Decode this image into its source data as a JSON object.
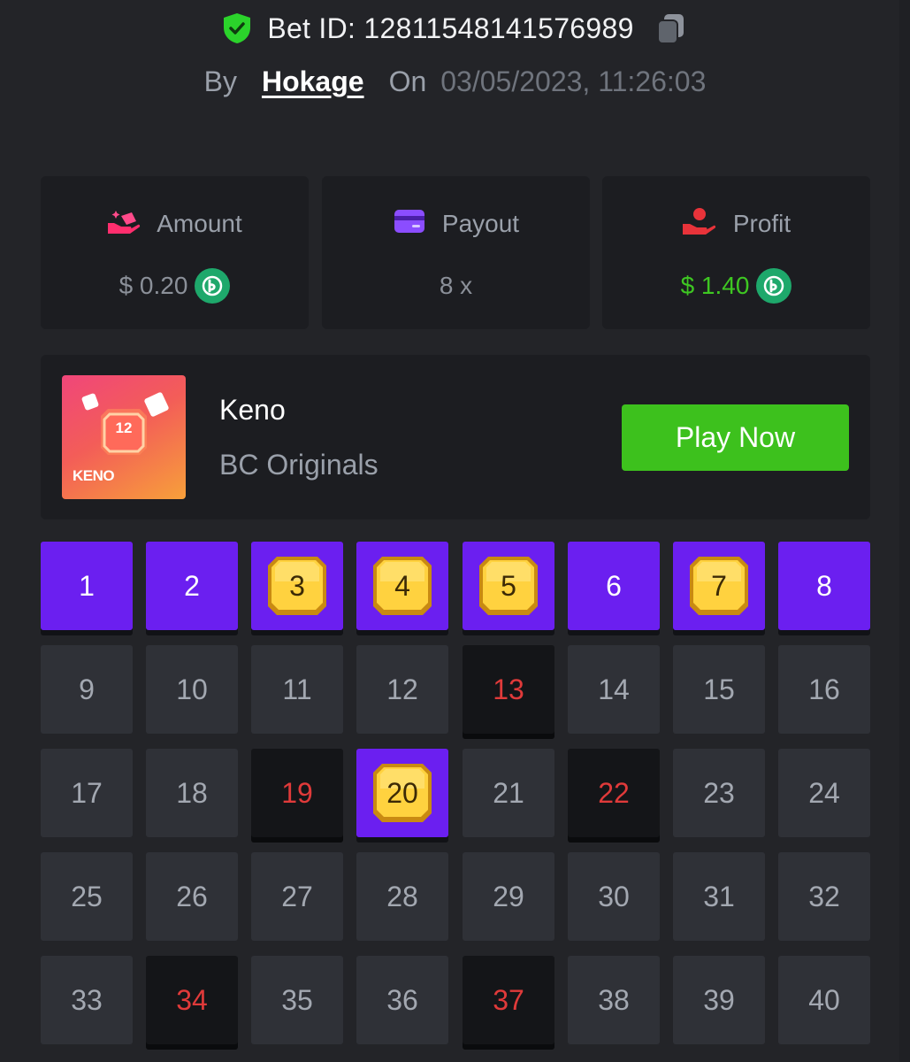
{
  "header": {
    "bet_id": "Bet ID: 12811548141576989",
    "by_label": "By",
    "username": "Hokage",
    "on_label": "On",
    "datetime": "03/05/2023, 11:26:03"
  },
  "stats": {
    "amount": {
      "label": "Amount",
      "value": "$ 0.20",
      "icon": "coins-hand-icon",
      "coin_icon": "bc-coin-icon"
    },
    "payout": {
      "label": "Payout",
      "value": "8 x",
      "icon": "card-icon"
    },
    "profit": {
      "label": "Profit",
      "value": "$ 1.40",
      "icon": "money-hand-icon",
      "coin_icon": "bc-coin-icon"
    }
  },
  "game": {
    "name": "Keno",
    "provider": "BC Originals",
    "play_label": "Play Now",
    "thumb_label": "KENO",
    "thumb_number": "12"
  },
  "grid": {
    "cells": [
      {
        "n": "1",
        "state": "picked"
      },
      {
        "n": "2",
        "state": "picked"
      },
      {
        "n": "3",
        "state": "hit"
      },
      {
        "n": "4",
        "state": "hit"
      },
      {
        "n": "5",
        "state": "hit"
      },
      {
        "n": "6",
        "state": "picked"
      },
      {
        "n": "7",
        "state": "hit"
      },
      {
        "n": "8",
        "state": "picked"
      },
      {
        "n": "9",
        "state": "empty"
      },
      {
        "n": "10",
        "state": "empty"
      },
      {
        "n": "11",
        "state": "empty"
      },
      {
        "n": "12",
        "state": "empty"
      },
      {
        "n": "13",
        "state": "miss"
      },
      {
        "n": "14",
        "state": "empty"
      },
      {
        "n": "15",
        "state": "empty"
      },
      {
        "n": "16",
        "state": "empty"
      },
      {
        "n": "17",
        "state": "empty"
      },
      {
        "n": "18",
        "state": "empty"
      },
      {
        "n": "19",
        "state": "miss"
      },
      {
        "n": "20",
        "state": "hit"
      },
      {
        "n": "21",
        "state": "empty"
      },
      {
        "n": "22",
        "state": "miss"
      },
      {
        "n": "23",
        "state": "empty"
      },
      {
        "n": "24",
        "state": "empty"
      },
      {
        "n": "25",
        "state": "empty"
      },
      {
        "n": "26",
        "state": "empty"
      },
      {
        "n": "27",
        "state": "empty"
      },
      {
        "n": "28",
        "state": "empty"
      },
      {
        "n": "29",
        "state": "empty"
      },
      {
        "n": "30",
        "state": "empty"
      },
      {
        "n": "31",
        "state": "empty"
      },
      {
        "n": "32",
        "state": "empty"
      },
      {
        "n": "33",
        "state": "empty"
      },
      {
        "n": "34",
        "state": "miss"
      },
      {
        "n": "35",
        "state": "empty"
      },
      {
        "n": "36",
        "state": "empty"
      },
      {
        "n": "37",
        "state": "miss"
      },
      {
        "n": "38",
        "state": "empty"
      },
      {
        "n": "39",
        "state": "empty"
      },
      {
        "n": "40",
        "state": "empty"
      }
    ]
  },
  "colors": {
    "background": "#232428",
    "card": "#1c1d21",
    "accent_purple": "#6b1ff0",
    "play_green": "#3dc11d",
    "profit_green": "#3ec722",
    "miss_red": "#e03a3a",
    "gem_yellow": "#ffd23f"
  }
}
